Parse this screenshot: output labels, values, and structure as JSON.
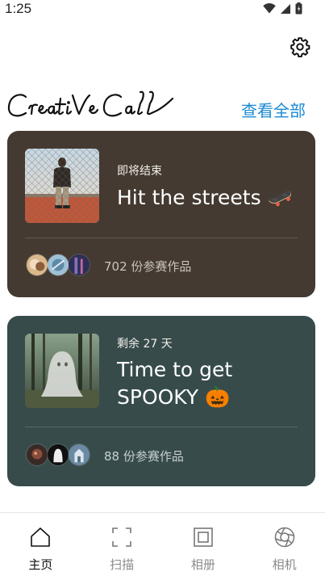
{
  "status_bar": {
    "time": "1:25",
    "icons": [
      "wifi-icon",
      "cellular-signal-icon",
      "battery-icon"
    ]
  },
  "header": {
    "brand_title": "Creative Call",
    "see_all_label": "查看全部",
    "settings_icon": "gear-icon"
  },
  "cards": [
    {
      "status": "即将结束",
      "title": "Hit the streets 🛹",
      "entries": "702 份参赛作品",
      "thumbnail": "person-at-chainlink-fence-image",
      "card_color": "#443a31"
    },
    {
      "status": "剩余 27 天",
      "title": "Time to get SPOOKY 🎃",
      "entries": "88 份参赛作品",
      "thumbnail": "ghost-in-forest-image",
      "card_color": "#374b4b"
    }
  ],
  "bottom_nav": {
    "items": [
      {
        "label": "主页",
        "icon": "home-icon",
        "active": true
      },
      {
        "label": "扫描",
        "icon": "scan-frame-icon",
        "active": false
      },
      {
        "label": "相册",
        "icon": "album-icon",
        "active": false
      },
      {
        "label": "相机",
        "icon": "camera-aperture-icon",
        "active": false
      }
    ]
  },
  "colors": {
    "accent": "#1b8bd6",
    "active_nav": "#111111",
    "inactive_nav": "#8a8a8a"
  }
}
